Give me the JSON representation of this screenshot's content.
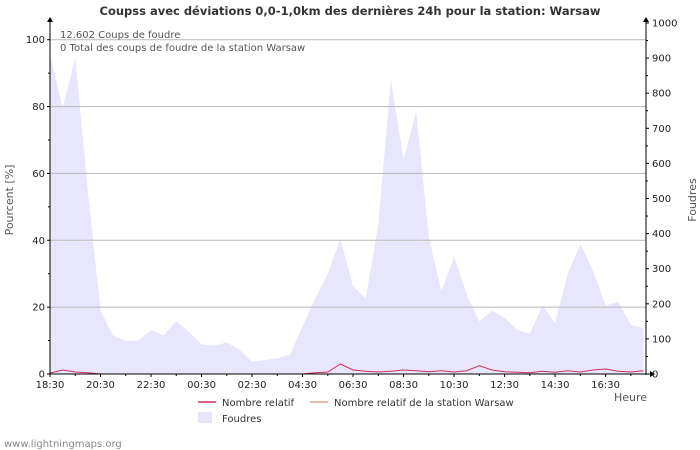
{
  "credit": "www.lightningmaps.org",
  "colors": {
    "area_fill": "#e8e6fc",
    "relative_line": "#cc3355",
    "station_line": "#e6a08c",
    "grid": "#b8b8b8",
    "axis": "#000000"
  },
  "chart_data": {
    "type": "area",
    "title": "Coupss avec déviations 0,0-1,0km des dernières 24h pour la station: Warsaw",
    "xlabel": "Heure",
    "ylabel_left": "Pourcent   [%]",
    "ylabel_right": "Foudres",
    "ylim_left": [
      0,
      105
    ],
    "ylim_right": [
      0,
      1000
    ],
    "yticks_left": [
      "0",
      "20",
      "40",
      "60",
      "80",
      "100"
    ],
    "yticks_right": [
      "0",
      "100",
      "200",
      "300",
      "400",
      "500",
      "600",
      "700",
      "800",
      "900",
      "1000"
    ],
    "xticks": [
      "18:30",
      "20:30",
      "22:30",
      "00:30",
      "02:30",
      "04:30",
      "06:30",
      "08:30",
      "10:30",
      "12:30",
      "14:30",
      "16:30"
    ],
    "info": {
      "line1": "12.602  Coups de foudre",
      "line2": "0 Total des coups de foudre de la station Warsaw"
    },
    "legend": {
      "relative": "Nombre relatif",
      "station": "Nombre relatif de la station Warsaw",
      "strikes": "Foudres"
    },
    "x_hours": [
      0,
      0.5,
      1,
      1.5,
      2,
      2.5,
      3,
      3.5,
      4,
      4.5,
      5,
      5.5,
      6,
      6.5,
      7,
      7.5,
      8,
      8.5,
      9,
      9.5,
      10,
      10.5,
      11,
      11.5,
      12,
      12.5,
      13,
      13.5,
      14,
      14.5,
      15,
      15.5,
      16,
      16.5,
      17,
      17.5,
      18,
      18.5,
      19,
      19.5,
      20,
      20.5,
      21,
      21.5,
      22,
      22.5,
      23,
      23.5
    ],
    "strikes": [
      910,
      760,
      900,
      520,
      180,
      110,
      95,
      95,
      125,
      110,
      150,
      120,
      85,
      80,
      90,
      70,
      35,
      40,
      45,
      55,
      135,
      215,
      285,
      385,
      250,
      215,
      425,
      840,
      610,
      750,
      390,
      235,
      335,
      225,
      150,
      180,
      160,
      125,
      115,
      195,
      145,
      285,
      370,
      295,
      195,
      205,
      140,
      130
    ],
    "relative_pct": [
      0.3,
      1.2,
      0.6,
      0.4,
      0,
      0,
      0,
      0,
      0,
      0,
      0,
      0,
      0,
      0,
      0,
      0,
      0,
      0,
      0,
      0,
      0,
      0.4,
      0.6,
      3.0,
      1.2,
      0.8,
      0.6,
      0.8,
      1.2,
      1.0,
      0.7,
      1.0,
      0.6,
      1.0,
      2.5,
      1.2,
      0.7,
      0.5,
      0.4,
      0.8,
      0.5,
      1.0,
      0.6,
      1.2,
      1.5,
      0.8,
      0.6,
      1.0
    ]
  }
}
